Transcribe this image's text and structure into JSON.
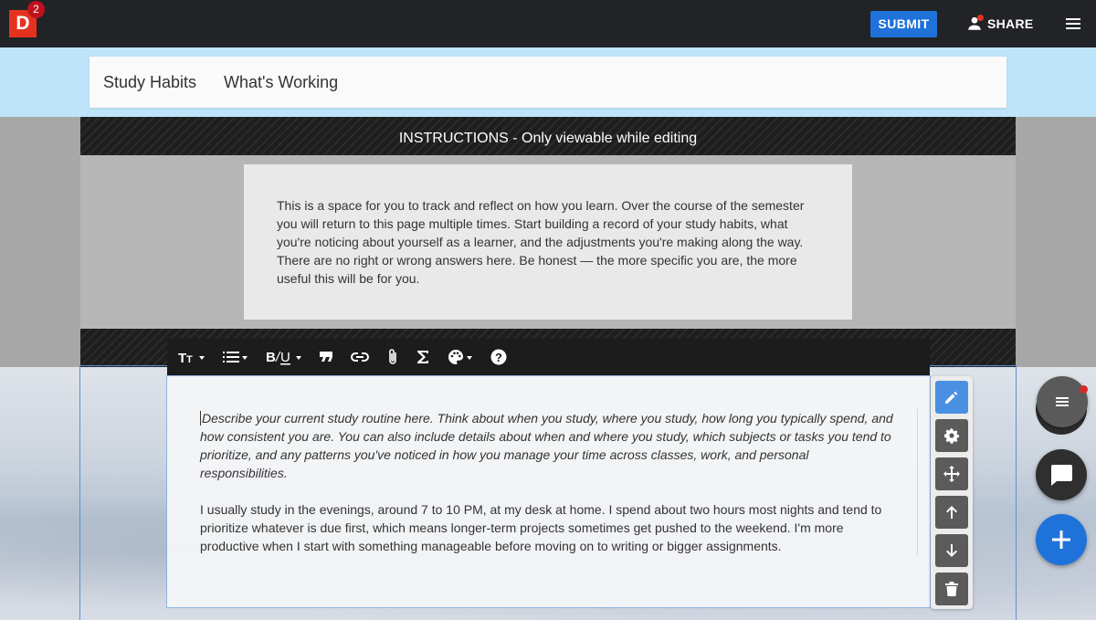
{
  "app": {
    "logo_letter": "D",
    "notification_count": "2",
    "submit_label": "SUBMIT",
    "share_label": "SHARE",
    "icons": [
      "person-icon",
      "hamburger-menu-icon"
    ]
  },
  "page": {
    "title": "Study Habits",
    "subtitle": "What's Working"
  },
  "instructions": {
    "header": "INSTRUCTIONS - Only viewable while editing",
    "body": "This is a space for you to track and reflect on how you learn. Over the course of the semester you will return to this page multiple times. Start building a record of your study habits, what you're noticing about yourself as a learner, and the adjustments you're making along the way. There are no right or wrong answers here. Be honest — the more specific you are, the more useful this will be for you."
  },
  "toolbar": {
    "tools": [
      "text-size-icon",
      "list-icon",
      "bold-italic-underline-icon",
      "quote-icon",
      "link-icon",
      "attachment-icon",
      "sigma-icon",
      "palette-icon",
      "help-icon"
    ]
  },
  "editor": {
    "prompt": "Describe your current study routine here. Think about when you study, where you study, how long you typically spend, and how consistent you are. You can also include details about when and where you study, which subjects or tasks you tend to prioritize, and any patterns you've noticed in how you manage your time across classes, work, and personal responsibilities.",
    "answer": "I usually study in the evenings, around 7 to 10 PM, at my desk at home. I spend about two hours most nights and tend to prioritize whatever is due first, which means longer-term projects sometimes get pushed to the weekend. I'm more productive when I start with something manageable before moving on to writing or bigger assignments."
  },
  "side_actions": [
    "edit-icon",
    "settings-icon",
    "move-icon",
    "arrow-up-icon",
    "arrow-down-icon",
    "delete-icon"
  ],
  "fabs": [
    "menu-fab",
    "comment-fab",
    "add-fab"
  ],
  "colors": {
    "topbar": "#222326",
    "submit": "#1f72d9",
    "title_strip": "#bde4f9",
    "logo": "#e5321f",
    "active_action": "#4a90e2",
    "add_fab": "#1f72d9"
  }
}
